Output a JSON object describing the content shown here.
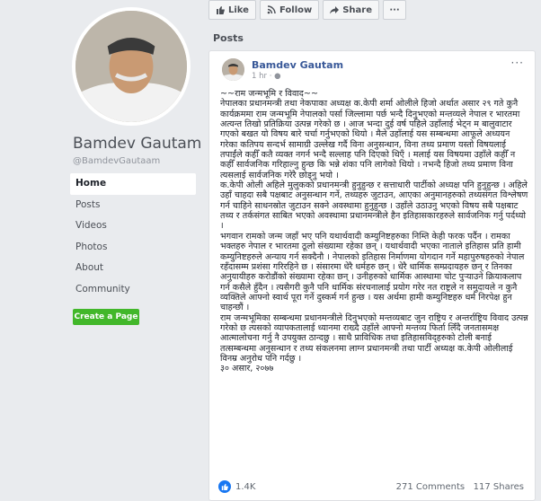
{
  "profile": {
    "name": "Bamdev Gautam",
    "handle": "@BamdevGautaam"
  },
  "nav": {
    "items": [
      {
        "label": "Home",
        "active": true
      },
      {
        "label": "Posts"
      },
      {
        "label": "Videos"
      },
      {
        "label": "Photos"
      },
      {
        "label": "About"
      },
      {
        "label": "Community"
      }
    ]
  },
  "create_page_label": "Create a Page",
  "actions": {
    "like": "Like",
    "follow": "Follow",
    "share": "Share",
    "more": "···"
  },
  "posts_heading": "Posts",
  "post": {
    "author": "Bamdev Gautam",
    "time": "1 hr",
    "more": "···",
    "paragraphs": [
      "~~राम जन्मभूमि र विवाद~~",
      "नेपालका प्रधानमन्त्री तथा नेकपाका अध्यक्ष क.केपी शर्मा ओलीले हिजो अर्थात असार २९ गते कुनै कार्यक्रममा राम जन्मभूमि नेपालको पर्सा जिल्लामा पर्छ भन्दै दिनुभएको मन्तव्यले नेपाल र भारतमा अत्यन्त तिखो प्रतिक्रिया उत्पन्न गरेको छ । आज भन्दा दुई वर्ष पहिले उहाँलाई भेट्न म बालुवाटार गएको बखत यो विषय बारे चर्चा गर्नुभएको थियो । मैले उहाँलाई यस सम्बन्धमा आफूले अध्ययन गरेका कतिपय सन्दर्भ सामाग्री उल्लेख गर्दै विना अनुसन्धान, विना तथ्य प्रमाण यस्तो विषयलाई तपाईंले कहीँ कतै व्यक्त नगर्न भन्दै सल्लाह पनि दिएको थिएँ । मलाई यस विषयमा उहाँले कहीँ न कहीँ सार्वजनिक गरिहाल्नु हुन्छ कि भन्ने शंका पनि लागेको थियो । नभन्दै हिजो तथ्य प्रमाण विना त्यसलाई सार्वजनिक गरेरै छोड्नु भयो ।",
      "क.केपी ओली अहिले मुलुकको प्रधानमन्त्री हुनुहुन्छ र सत्ताधारी पार्टीको अध्यक्ष पनि हुनुहुन्छ । अहिले उहाँ चाहदा सबै पक्षबाट अनुसन्धान गर्ने, तथ्यहरु जुटाउन, आएका अनुमानहरुको तथ्यसंगत विश्लेषण गर्न चाहिने साधनस्रोत जुटाउन सक्ने अवस्थामा हुनुहुन्छ । उहाँले उठाउनु भएको विषय सबै पक्षबाट तथ्य र तर्कसंगत साबित भएको अवस्थामा प्रधानमन्त्रीले हैन इतिहासकारहरुले सार्वजनिक गर्नु पर्दथ्यो ।",
      "भगवान रामको जन्म जहाँ भए पनि यथार्थवादी कम्युनिष्टहरुका निम्ति केही फरक पर्दैन । रामका भक्तहरु नेपाल र भारतमा ठूलो संख्यामा रहेका छन् । यथार्थवादी भएका नाताले इतिहास प्रति हामी कम्युनिष्टहरुले अन्याय गर्न सक्दैनौ । नेपालको इतिहास निर्माणमा योगदान गर्ने महापुरुषहरुको नेपाल रहँदासम्म प्रशंसा गरिरहिने छ । संसारमा धेरै धर्महरु छन् । धेरै धार्मिक सम्प्रदायहरु छन् र तिनका अनुयायीहरु करोडौंको संख्यामा रहेका छन् । उनीहरुको धार्मिक आस्थामा चोट पुऱ्याउने क्रियाकलाप गर्न कसैले हुँदैन । त्यसैगरी कुनै पनि धार्मिक संरचनालाई प्रयोग गरेर नत राष्ट्रले न समुदायले न कुनै व्यक्तिले आफ्नो स्वार्थ पूरा गर्ने दुस्कर्म गर्न हुन्छ । यस अर्थमा हामी कम्युनिष्टहरु धर्म निरपेक्ष हुन चाहन्छौं ।",
      "राम जन्मभूमिका सम्बन्धमा प्रधानमन्त्रीले दिनुभएको मन्तव्यबाट जुन राष्ट्रिय र अन्तर्राष्ट्रिय विवाद उत्पन्न गरेको छ त्यसको व्यापकतालाई ध्यानमा राख्दै उहाँले आफ्नो मन्तव्य फिर्ता लिँदै जनतासमक्ष आत्मालोचना गर्नु नै उपयुक्त ठान्दछु । साथै प्राविधिक तथा इतिहासविद्हरुको टोली बनाई तत्सम्बन्धमा अनुसन्धान र तथ्य संकलनमा लाग्न प्रधानमन्त्री तथा पार्टी अध्यक्ष क.केपी ओलीलाई विनम्र अनुरोध पनि गर्दछु ।",
      "३० असार, २०७७"
    ],
    "like_count": "1.4K",
    "comments": "271 Comments",
    "shares": "117 Shares"
  },
  "colors": {
    "background": "#e9ebee",
    "link": "#385898",
    "green": "#42b72a",
    "like_blue": "#1877f2"
  }
}
